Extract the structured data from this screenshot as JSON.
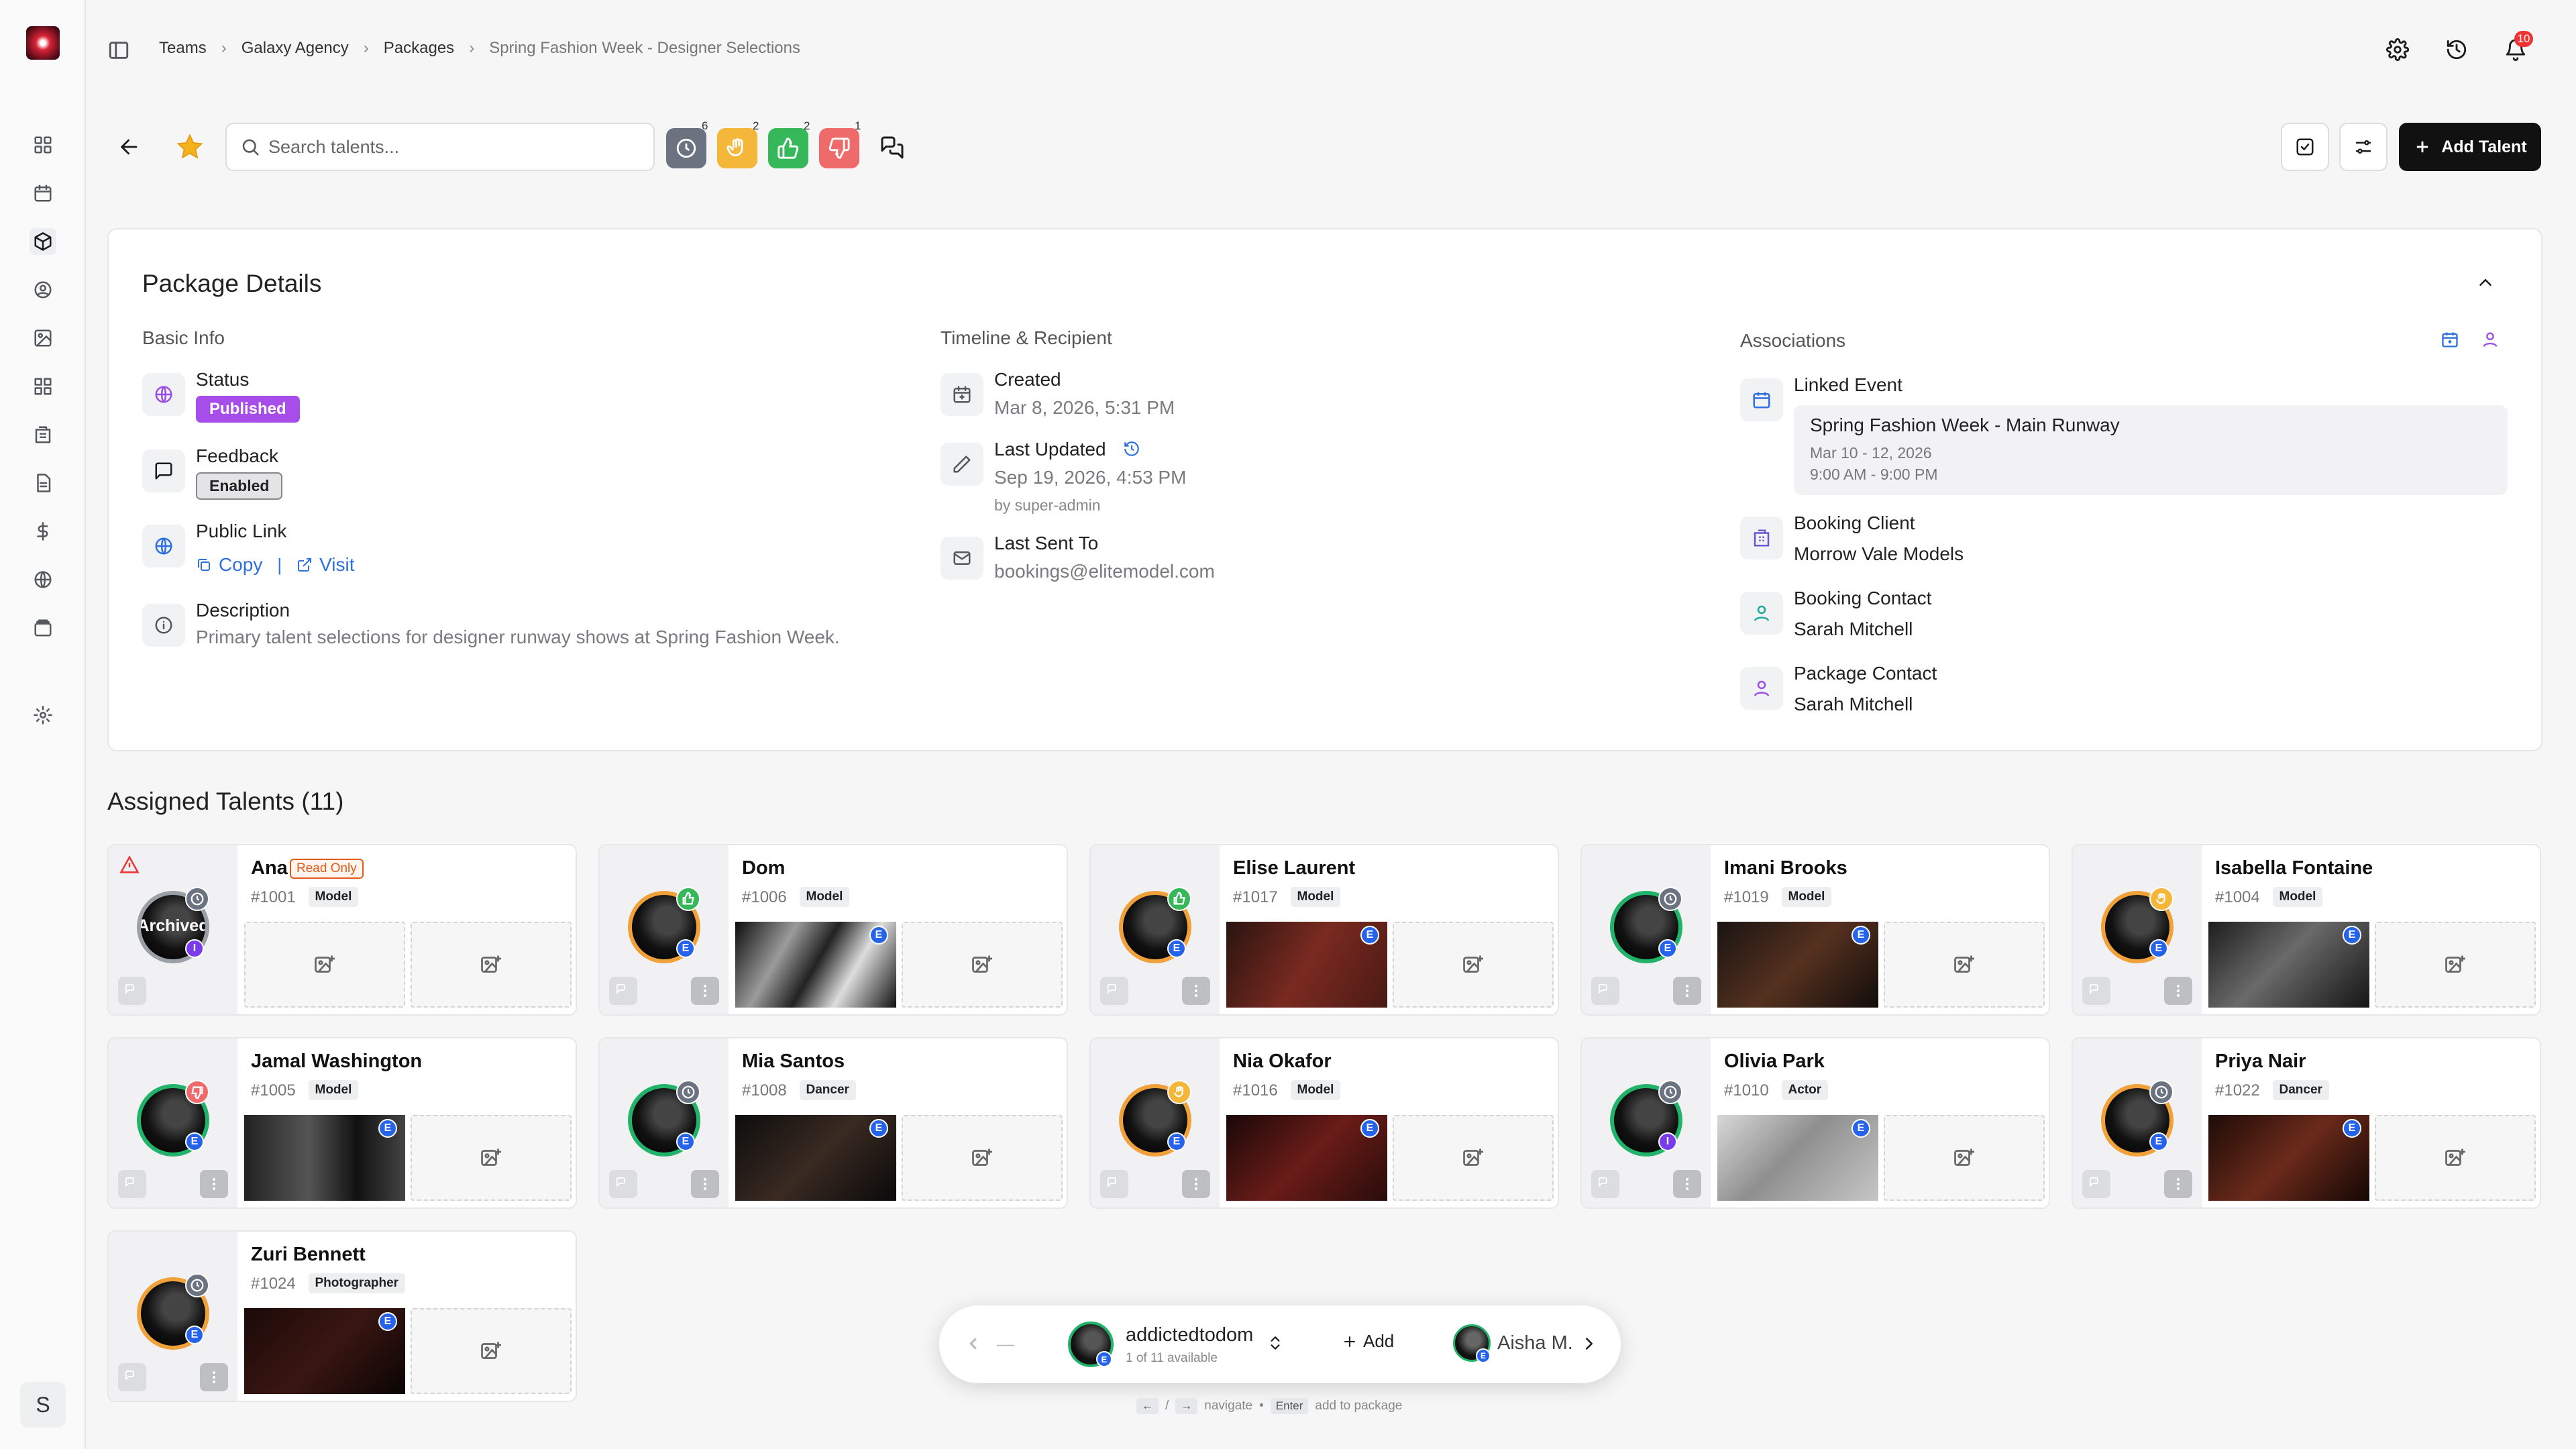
{
  "breadcrumb": [
    "Teams",
    "Galaxy Agency",
    "Packages",
    "Spring Fashion Week - Designer Selections"
  ],
  "notifications_count": "10",
  "user_initial": "S",
  "search": {
    "placeholder": "Search talents..."
  },
  "filters": [
    {
      "name": "pending",
      "count": "6",
      "color": "#6b7280"
    },
    {
      "name": "hold",
      "count": "2",
      "color": "#f4b73a"
    },
    {
      "name": "approved",
      "count": "2",
      "color": "#35b75a"
    },
    {
      "name": "rejected",
      "count": "1",
      "color": "#ef6b6b"
    }
  ],
  "add_talent_label": "Add Talent",
  "package": {
    "title": "Package Details",
    "basic_info_heading": "Basic Info",
    "status_label": "Status",
    "status_value": "Published",
    "feedback_label": "Feedback",
    "feedback_value": "Enabled",
    "public_link_label": "Public Link",
    "copy_label": "Copy",
    "visit_label": "Visit",
    "description_label": "Description",
    "description_value": "Primary talent selections for designer runway shows at Spring Fashion Week.",
    "timeline_heading": "Timeline & Recipient",
    "created_label": "Created",
    "created_value": "Mar 8, 2026, 5:31 PM",
    "updated_label": "Last Updated",
    "updated_value": "Sep 19, 2026, 4:53 PM",
    "updated_by": "by super-admin",
    "sent_label": "Last Sent To",
    "sent_value": "bookings@elitemodel.com",
    "associations_heading": "Associations",
    "linked_event_label": "Linked Event",
    "event_name": "Spring Fashion Week - Main Runway",
    "event_dates": "Mar 10 - 12, 2026",
    "event_time": "9:00 AM - 9:00 PM",
    "booking_client_label": "Booking Client",
    "booking_client_value": "Morrow Vale Models",
    "booking_contact_label": "Booking Contact",
    "booking_contact_value": "Sarah Mitchell",
    "package_contact_label": "Package Contact",
    "package_contact_value": "Sarah Mitchell"
  },
  "assigned_title": "Assigned Talents (11)",
  "talents": [
    {
      "name": "Ana",
      "id": "#1001",
      "role": "Model",
      "status": "pending",
      "tag": "Read Only",
      "archived": "Archived",
      "photo": false
    },
    {
      "name": "Dom",
      "id": "#1006",
      "role": "Model",
      "status": "approved",
      "photo": true
    },
    {
      "name": "Elise Laurent",
      "id": "#1017",
      "role": "Model",
      "status": "approved",
      "photo": true
    },
    {
      "name": "Imani Brooks",
      "id": "#1019",
      "role": "Model",
      "status": "pending",
      "photo": true
    },
    {
      "name": "Isabella Fontaine",
      "id": "#1004",
      "role": "Model",
      "status": "hold",
      "photo": true
    },
    {
      "name": "Jamal Washington",
      "id": "#1005",
      "role": "Model",
      "status": "rejected",
      "photo": true
    },
    {
      "name": "Mia Santos",
      "id": "#1008",
      "role": "Dancer",
      "status": "pending",
      "photo": true
    },
    {
      "name": "Nia Okafor",
      "id": "#1016",
      "role": "Model",
      "status": "hold",
      "photo": true
    },
    {
      "name": "Olivia Park",
      "id": "#1010",
      "role": "Actor",
      "status": "pending",
      "photo": true
    },
    {
      "name": "Priya Nair",
      "id": "#1022",
      "role": "Dancer",
      "status": "pending",
      "photo": true
    },
    {
      "name": "Zuri Bennett",
      "id": "#1024",
      "role": "Photographer",
      "status": "pending",
      "photo": true
    }
  ],
  "bottom_nav": {
    "prev_label": "—",
    "current_name": "addictedtodom",
    "current_sub": "1 of 11 available",
    "add_label": "Add",
    "next_name": "Aisha M."
  },
  "hints": {
    "sep": "/",
    "navigate": "navigate",
    "enter": "Enter",
    "add_to_package": "add to package"
  }
}
